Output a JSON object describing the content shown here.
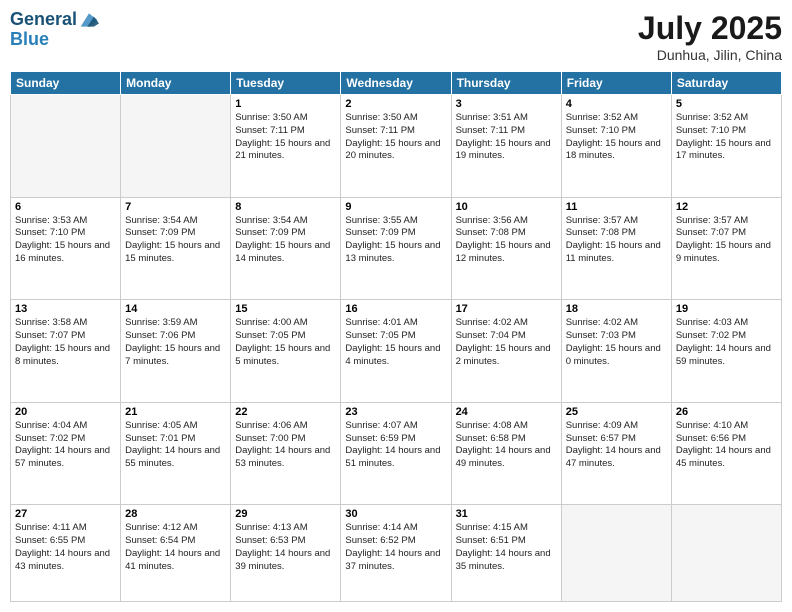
{
  "logo": {
    "line1": "General",
    "line2": "Blue"
  },
  "title": "July 2025",
  "subtitle": "Dunhua, Jilin, China",
  "days_header": [
    "Sunday",
    "Monday",
    "Tuesday",
    "Wednesday",
    "Thursday",
    "Friday",
    "Saturday"
  ],
  "weeks": [
    [
      {
        "day": "",
        "sunrise": "",
        "sunset": "",
        "daylight": ""
      },
      {
        "day": "",
        "sunrise": "",
        "sunset": "",
        "daylight": ""
      },
      {
        "day": "1",
        "sunrise": "Sunrise: 3:50 AM",
        "sunset": "Sunset: 7:11 PM",
        "daylight": "Daylight: 15 hours and 21 minutes."
      },
      {
        "day": "2",
        "sunrise": "Sunrise: 3:50 AM",
        "sunset": "Sunset: 7:11 PM",
        "daylight": "Daylight: 15 hours and 20 minutes."
      },
      {
        "day": "3",
        "sunrise": "Sunrise: 3:51 AM",
        "sunset": "Sunset: 7:11 PM",
        "daylight": "Daylight: 15 hours and 19 minutes."
      },
      {
        "day": "4",
        "sunrise": "Sunrise: 3:52 AM",
        "sunset": "Sunset: 7:10 PM",
        "daylight": "Daylight: 15 hours and 18 minutes."
      },
      {
        "day": "5",
        "sunrise": "Sunrise: 3:52 AM",
        "sunset": "Sunset: 7:10 PM",
        "daylight": "Daylight: 15 hours and 17 minutes."
      }
    ],
    [
      {
        "day": "6",
        "sunrise": "Sunrise: 3:53 AM",
        "sunset": "Sunset: 7:10 PM",
        "daylight": "Daylight: 15 hours and 16 minutes."
      },
      {
        "day": "7",
        "sunrise": "Sunrise: 3:54 AM",
        "sunset": "Sunset: 7:09 PM",
        "daylight": "Daylight: 15 hours and 15 minutes."
      },
      {
        "day": "8",
        "sunrise": "Sunrise: 3:54 AM",
        "sunset": "Sunset: 7:09 PM",
        "daylight": "Daylight: 15 hours and 14 minutes."
      },
      {
        "day": "9",
        "sunrise": "Sunrise: 3:55 AM",
        "sunset": "Sunset: 7:09 PM",
        "daylight": "Daylight: 15 hours and 13 minutes."
      },
      {
        "day": "10",
        "sunrise": "Sunrise: 3:56 AM",
        "sunset": "Sunset: 7:08 PM",
        "daylight": "Daylight: 15 hours and 12 minutes."
      },
      {
        "day": "11",
        "sunrise": "Sunrise: 3:57 AM",
        "sunset": "Sunset: 7:08 PM",
        "daylight": "Daylight: 15 hours and 11 minutes."
      },
      {
        "day": "12",
        "sunrise": "Sunrise: 3:57 AM",
        "sunset": "Sunset: 7:07 PM",
        "daylight": "Daylight: 15 hours and 9 minutes."
      }
    ],
    [
      {
        "day": "13",
        "sunrise": "Sunrise: 3:58 AM",
        "sunset": "Sunset: 7:07 PM",
        "daylight": "Daylight: 15 hours and 8 minutes."
      },
      {
        "day": "14",
        "sunrise": "Sunrise: 3:59 AM",
        "sunset": "Sunset: 7:06 PM",
        "daylight": "Daylight: 15 hours and 7 minutes."
      },
      {
        "day": "15",
        "sunrise": "Sunrise: 4:00 AM",
        "sunset": "Sunset: 7:05 PM",
        "daylight": "Daylight: 15 hours and 5 minutes."
      },
      {
        "day": "16",
        "sunrise": "Sunrise: 4:01 AM",
        "sunset": "Sunset: 7:05 PM",
        "daylight": "Daylight: 15 hours and 4 minutes."
      },
      {
        "day": "17",
        "sunrise": "Sunrise: 4:02 AM",
        "sunset": "Sunset: 7:04 PM",
        "daylight": "Daylight: 15 hours and 2 minutes."
      },
      {
        "day": "18",
        "sunrise": "Sunrise: 4:02 AM",
        "sunset": "Sunset: 7:03 PM",
        "daylight": "Daylight: 15 hours and 0 minutes."
      },
      {
        "day": "19",
        "sunrise": "Sunrise: 4:03 AM",
        "sunset": "Sunset: 7:02 PM",
        "daylight": "Daylight: 14 hours and 59 minutes."
      }
    ],
    [
      {
        "day": "20",
        "sunrise": "Sunrise: 4:04 AM",
        "sunset": "Sunset: 7:02 PM",
        "daylight": "Daylight: 14 hours and 57 minutes."
      },
      {
        "day": "21",
        "sunrise": "Sunrise: 4:05 AM",
        "sunset": "Sunset: 7:01 PM",
        "daylight": "Daylight: 14 hours and 55 minutes."
      },
      {
        "day": "22",
        "sunrise": "Sunrise: 4:06 AM",
        "sunset": "Sunset: 7:00 PM",
        "daylight": "Daylight: 14 hours and 53 minutes."
      },
      {
        "day": "23",
        "sunrise": "Sunrise: 4:07 AM",
        "sunset": "Sunset: 6:59 PM",
        "daylight": "Daylight: 14 hours and 51 minutes."
      },
      {
        "day": "24",
        "sunrise": "Sunrise: 4:08 AM",
        "sunset": "Sunset: 6:58 PM",
        "daylight": "Daylight: 14 hours and 49 minutes."
      },
      {
        "day": "25",
        "sunrise": "Sunrise: 4:09 AM",
        "sunset": "Sunset: 6:57 PM",
        "daylight": "Daylight: 14 hours and 47 minutes."
      },
      {
        "day": "26",
        "sunrise": "Sunrise: 4:10 AM",
        "sunset": "Sunset: 6:56 PM",
        "daylight": "Daylight: 14 hours and 45 minutes."
      }
    ],
    [
      {
        "day": "27",
        "sunrise": "Sunrise: 4:11 AM",
        "sunset": "Sunset: 6:55 PM",
        "daylight": "Daylight: 14 hours and 43 minutes."
      },
      {
        "day": "28",
        "sunrise": "Sunrise: 4:12 AM",
        "sunset": "Sunset: 6:54 PM",
        "daylight": "Daylight: 14 hours and 41 minutes."
      },
      {
        "day": "29",
        "sunrise": "Sunrise: 4:13 AM",
        "sunset": "Sunset: 6:53 PM",
        "daylight": "Daylight: 14 hours and 39 minutes."
      },
      {
        "day": "30",
        "sunrise": "Sunrise: 4:14 AM",
        "sunset": "Sunset: 6:52 PM",
        "daylight": "Daylight: 14 hours and 37 minutes."
      },
      {
        "day": "31",
        "sunrise": "Sunrise: 4:15 AM",
        "sunset": "Sunset: 6:51 PM",
        "daylight": "Daylight: 14 hours and 35 minutes."
      },
      {
        "day": "",
        "sunrise": "",
        "sunset": "",
        "daylight": ""
      },
      {
        "day": "",
        "sunrise": "",
        "sunset": "",
        "daylight": ""
      }
    ]
  ]
}
